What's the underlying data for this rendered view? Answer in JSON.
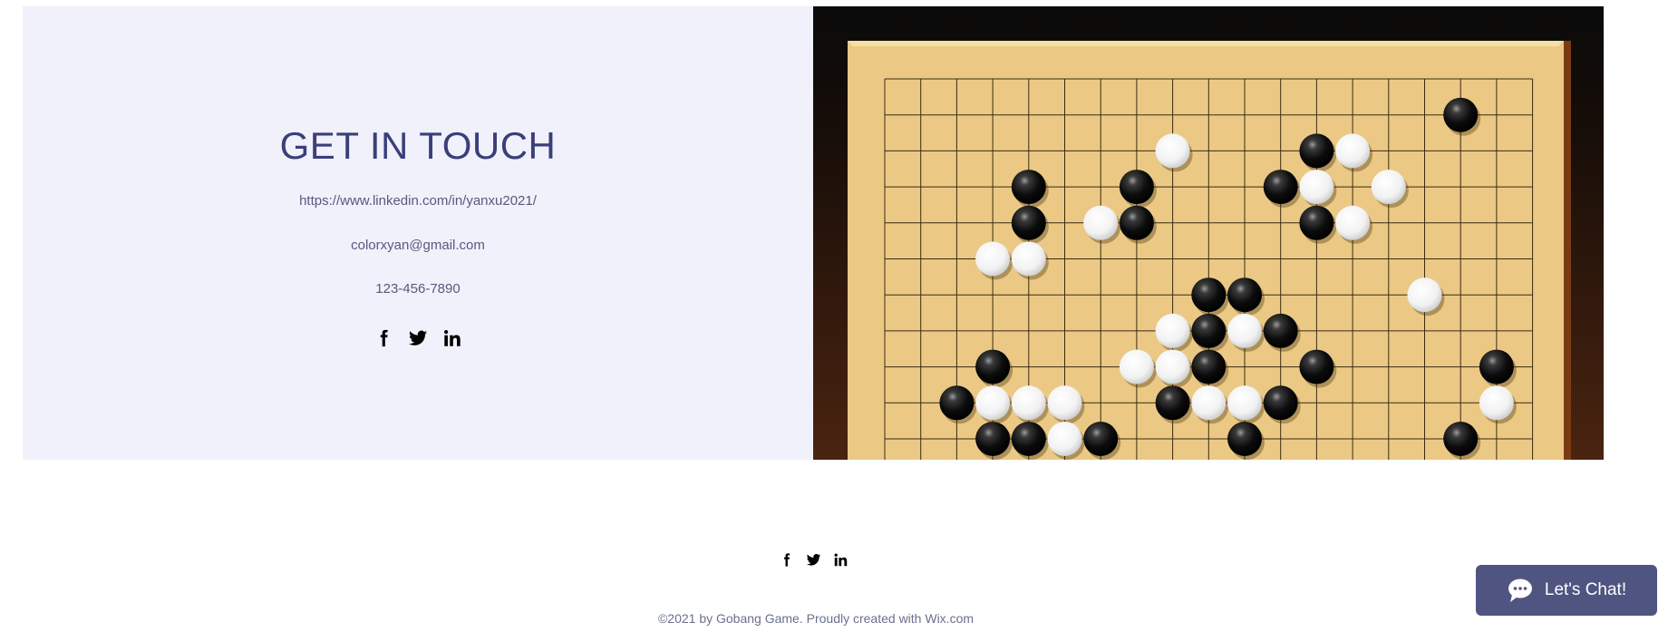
{
  "contact": {
    "title": "GET IN TOUCH",
    "linkedin": "https://www.linkedin.com/in/yanxu2021/",
    "email": "colorxyan@gmail.com",
    "phone": "123-456-7890"
  },
  "social_icons": [
    "facebook-icon",
    "twitter-icon",
    "linkedin-icon"
  ],
  "footer": {
    "copyright": "©2021 by Gobang Game. Proudly created with Wix.com"
  },
  "chat": {
    "label": "Let's Chat!",
    "icon": "chat-bubble-icon"
  },
  "board_image": {
    "black_stones": [
      [
        16,
        1
      ],
      [
        12,
        2
      ],
      [
        4,
        3
      ],
      [
        7,
        3
      ],
      [
        11,
        3
      ],
      [
        4,
        4
      ],
      [
        7,
        4
      ],
      [
        12,
        4
      ],
      [
        9,
        6
      ],
      [
        10,
        6
      ],
      [
        9,
        7
      ],
      [
        11,
        7
      ],
      [
        3,
        8
      ],
      [
        9,
        8
      ],
      [
        12,
        8
      ],
      [
        17,
        8
      ],
      [
        2,
        9
      ],
      [
        8,
        9
      ],
      [
        11,
        9
      ],
      [
        3,
        10
      ],
      [
        4,
        10
      ],
      [
        6,
        10
      ],
      [
        10,
        10
      ],
      [
        16,
        10
      ]
    ],
    "white_stones": [
      [
        8,
        2
      ],
      [
        13,
        2
      ],
      [
        12,
        3
      ],
      [
        14,
        3
      ],
      [
        6,
        4
      ],
      [
        13,
        4
      ],
      [
        3,
        5
      ],
      [
        4,
        5
      ],
      [
        15,
        6
      ],
      [
        8,
        7
      ],
      [
        10,
        7
      ],
      [
        7,
        8
      ],
      [
        8,
        8
      ],
      [
        3,
        9
      ],
      [
        4,
        9
      ],
      [
        5,
        9
      ],
      [
        9,
        9
      ],
      [
        10,
        9
      ],
      [
        17,
        9
      ],
      [
        5,
        10
      ]
    ],
    "colors": {
      "board": "#ebc985",
      "frame": "#0b0b0b",
      "wood": "#4a2410",
      "line": "#3a2a10"
    }
  }
}
